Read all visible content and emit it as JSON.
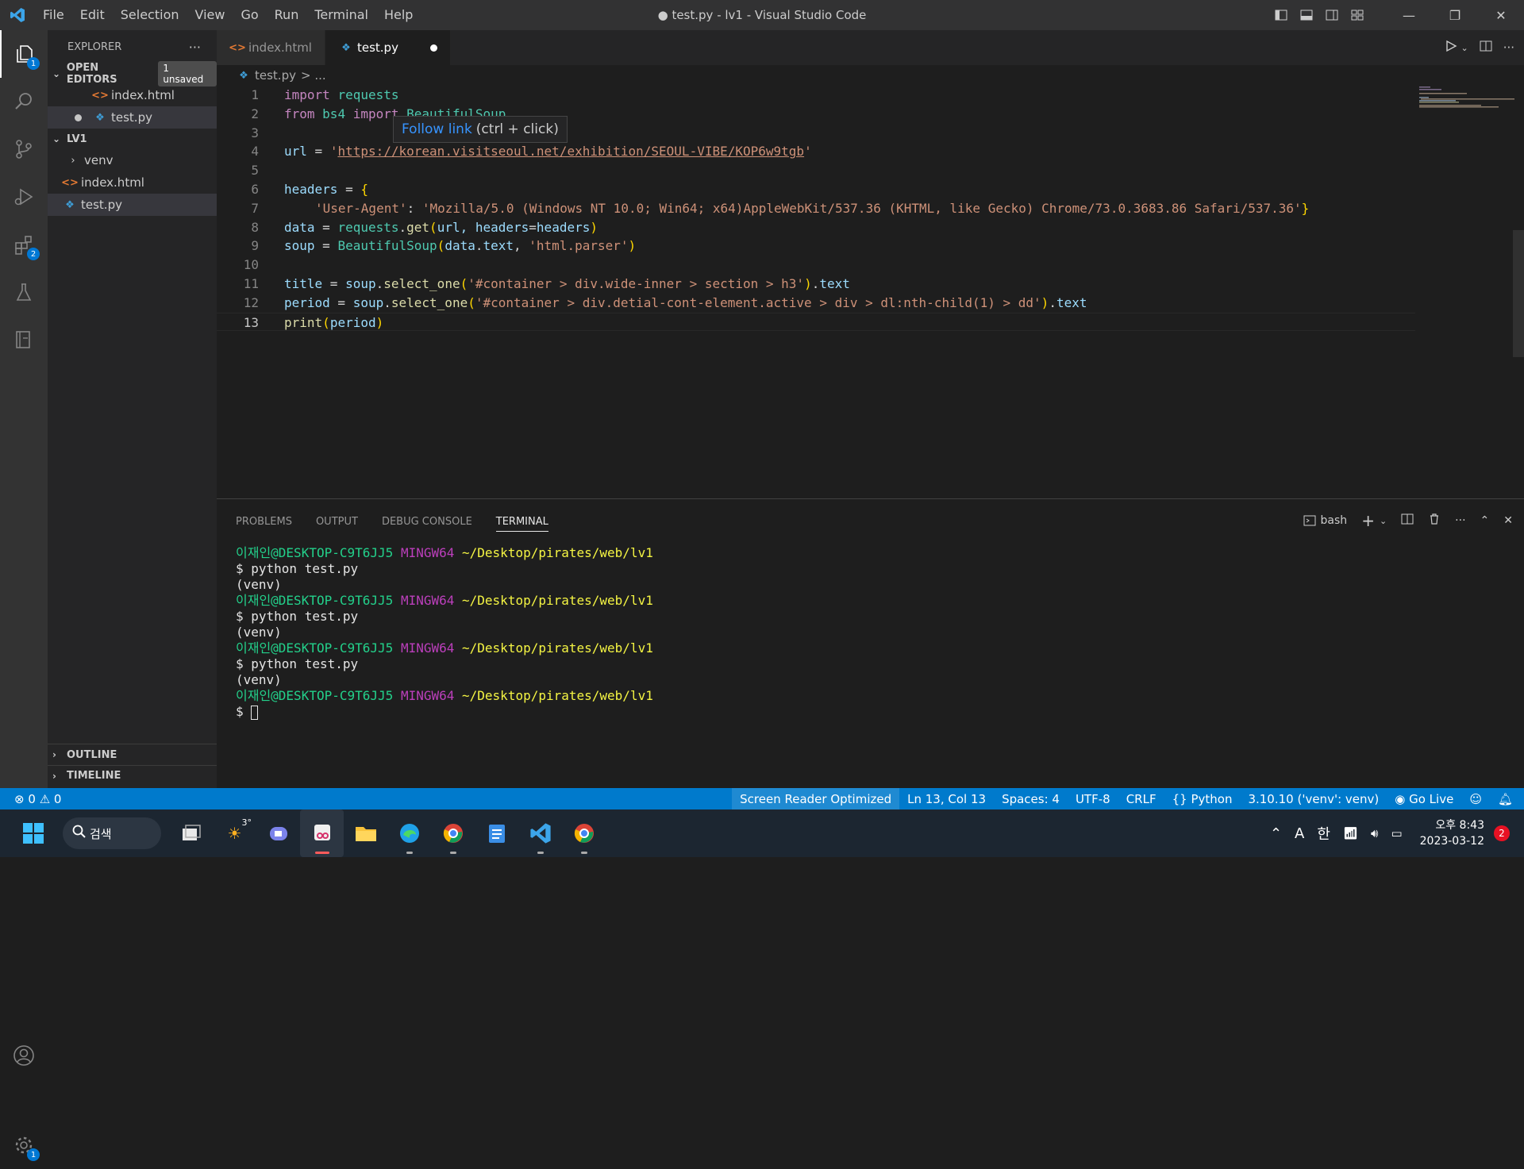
{
  "titlebar": {
    "title": "● test.py - lv1 - Visual Studio Code",
    "menu": [
      "File",
      "Edit",
      "Selection",
      "View",
      "Go",
      "Run",
      "Terminal",
      "Help"
    ]
  },
  "activity": {
    "explorer_badge": "1",
    "extensions_badge": "2",
    "settings_badge": "1"
  },
  "sidebar": {
    "header": "EXPLORER",
    "open_editors_label": "OPEN EDITORS",
    "unsaved_badge": "1 unsaved",
    "open_editors": [
      "index.html",
      "test.py"
    ],
    "folder_label": "LV1",
    "folder_items": [
      "venv",
      "index.html",
      "test.py"
    ],
    "outline_label": "OUTLINE",
    "timeline_label": "TIMELINE"
  },
  "tabs": [
    {
      "label": "index.html"
    },
    {
      "label": "test.py"
    }
  ],
  "breadcrumb": {
    "file": "test.py",
    "rest": "> ..."
  },
  "hover": {
    "link": "Follow link",
    "hint": "(ctrl + click)"
  },
  "editor": {
    "line_numbers": [
      "1",
      "2",
      "3",
      "4",
      "5",
      "6",
      "7",
      "8",
      "9",
      "10",
      "11",
      "12",
      "13"
    ],
    "code": {
      "l1_kw": "import",
      "l1_mod": "requests",
      "l2_kw1": "from",
      "l2_mod": "bs4",
      "l2_kw2": "import",
      "l2_rest": "BeautifulSoup",
      "l4_var": "url",
      "l4_eq": " = ",
      "l4_q1": "'",
      "l4_url": "https://korean.visitseoul.net/exhibition/SEOUL-VIBE/KOP6w9tgb",
      "l4_q2": "'",
      "l6_var": "headers",
      "l6_eq": " = ",
      "l6_brace": "{",
      "l7_key": "'User-Agent'",
      "l7_colon": ": ",
      "l7_val": "'Mozilla/5.0 (Windows NT 10.0; Win64; x64)AppleWebKit/537.36 (KHTML, like Gecko) Chrome/73.0.3683.86 Safari/537.36'",
      "l7_brace": "}",
      "l8_var": "data",
      "l8_eq": " = ",
      "l8_mod": "requests",
      "l8_dot": ".",
      "l8_fn": "get",
      "l8_p1": "(",
      "l8_args": "url, headers",
      "l8_eq2": "=",
      "l8_arg2": "headers",
      "l8_p2": ")",
      "l9_var": "soup",
      "l9_eq": " = ",
      "l9_fn": "BeautifulSoup",
      "l9_p1": "(",
      "l9_a1": "data",
      "l9_dot": ".",
      "l9_a2": "text",
      "l9_comma": ", ",
      "l9_str": "'html.parser'",
      "l9_p2": ")",
      "l11_var": "title",
      "l11_eq": " = ",
      "l11_obj": "soup",
      "l11_dot": ".",
      "l11_fn": "select_one",
      "l11_p1": "(",
      "l11_str": "'#container > div.wide-inner > section > h3'",
      "l11_p2": ")",
      "l11_dot2": ".",
      "l11_attr": "text",
      "l12_var": "period",
      "l12_eq": " = ",
      "l12_obj": "soup",
      "l12_dot": ".",
      "l12_fn": "select_one",
      "l12_p1": "(",
      "l12_str": "'#container > div.detial-cont-element.active > div > dl:nth-child(1) > dd'",
      "l12_p2": ")",
      "l12_dot2": ".",
      "l12_attr": "text",
      "l13_fn": "print",
      "l13_p1": "(",
      "l13_arg": "period",
      "l13_p2": ")"
    }
  },
  "panel": {
    "tabs": [
      "PROBLEMS",
      "OUTPUT",
      "DEBUG CONSOLE",
      "TERMINAL"
    ],
    "shell": "bash",
    "terminal": {
      "user": "이재인@DESKTOP-C9T6JJ5",
      "msys": "MINGW64",
      "path": "~/Desktop/pirates/web/lv1",
      "cmd": "$ python test.py",
      "venv": "(venv)",
      "prompt": "$ "
    }
  },
  "statusbar": {
    "errors": "0",
    "warnings": "0",
    "screen_reader": "Screen Reader Optimized",
    "position": "Ln 13, Col 13",
    "spaces": "Spaces: 4",
    "encoding": "UTF-8",
    "eol": "CRLF",
    "language": "Python",
    "interpreter": "3.10.10 ('venv': venv)",
    "golive": "Go Live"
  },
  "taskbar": {
    "search": "검색",
    "weather": "3°",
    "ime_mode": "A",
    "ime_lang": "한",
    "time": "오후 8:43",
    "date": "2023-03-12",
    "notifications": "2"
  }
}
